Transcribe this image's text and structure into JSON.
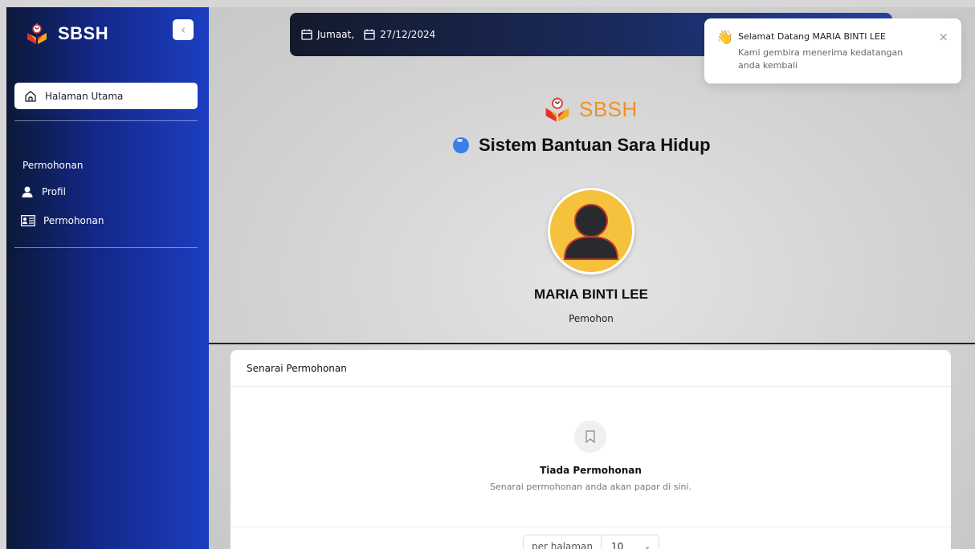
{
  "sidebar": {
    "brand": "SBSH",
    "collapse_icon": "chevron-left-icon",
    "home_label": "Halaman Utama",
    "section_title": "Permohonan",
    "items": [
      {
        "label": "Profil",
        "icon": "user-icon"
      },
      {
        "label": "Permohonan",
        "icon": "id-card-icon"
      }
    ]
  },
  "datebar": {
    "day": "Jumaat,",
    "date": "27/12/2024"
  },
  "toast": {
    "icon": "👋",
    "title": "Selamat Datang MARIA BINTI LEE",
    "message": "Kami gembira menerima kedatangan anda kembali",
    "close": "×"
  },
  "header": {
    "logo_text": "SBSH",
    "system_title": "Sistem Bantuan Sara Hidup"
  },
  "profile": {
    "name": "MARIA BINTI LEE",
    "role": "Pemohon"
  },
  "applications": {
    "title": "Senarai Permohonan",
    "empty_title": "Tiada Permohonan",
    "empty_desc": "Senarai permohonan anda akan papar di sini.",
    "per_page_label": "per halaman",
    "per_page_value": "10"
  },
  "colors": {
    "accent_orange": "#f39024",
    "sidebar_blue": "#1c3ec0",
    "avatar_yellow": "#f6c23e"
  }
}
